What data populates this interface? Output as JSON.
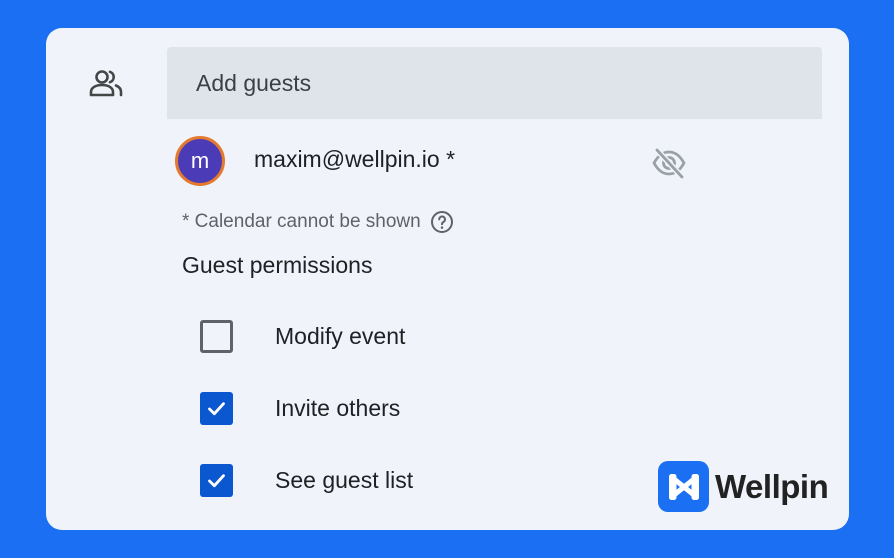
{
  "guests": {
    "input_placeholder": "Add guests",
    "list": [
      {
        "avatar_initial": "m",
        "email": "maxim@wellpin.io *",
        "visibility": "visibility-off-icon"
      }
    ],
    "calendar_note": "* Calendar cannot be shown"
  },
  "permissions": {
    "title": "Guest permissions",
    "items": [
      {
        "label": "Modify event",
        "checked": false
      },
      {
        "label": "Invite others",
        "checked": true
      },
      {
        "label": "See guest list",
        "checked": true
      }
    ]
  },
  "brand": {
    "name": "Wellpin"
  },
  "colors": {
    "accent": "#0b57d0",
    "frame": "#1a6ff2",
    "card": "#f0f4fa",
    "avatar_bg": "#4c3bb7",
    "avatar_ring": "#e37a2e"
  }
}
